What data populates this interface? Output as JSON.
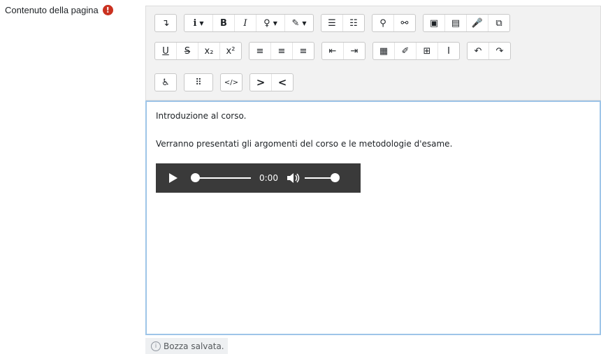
{
  "field": {
    "label": "Contenuto della pagina",
    "required_icon": "exclamation-icon"
  },
  "toolbar": {
    "rows": [
      [
        [
          {
            "name": "collapse-button",
            "icon": "collapse-icon",
            "glyph": "↴"
          }
        ],
        [
          {
            "name": "style-dropdown",
            "icon": "info-i-icon",
            "glyph": "i",
            "caret": true
          },
          {
            "name": "bold-button",
            "icon": "bold-icon",
            "glyph": "B"
          },
          {
            "name": "italic-button",
            "icon": "italic-icon",
            "glyph": "I"
          },
          {
            "name": "accessibility-checker-dropdown",
            "icon": "lightbulb-icon",
            "glyph": "♀",
            "caret": true
          },
          {
            "name": "font-color-dropdown",
            "icon": "paintbrush-icon",
            "glyph": "✎",
            "caret": true
          }
        ],
        [
          {
            "name": "unordered-list-button",
            "icon": "bulleted-list-icon",
            "glyph": "☰"
          },
          {
            "name": "ordered-list-button",
            "icon": "numbered-list-icon",
            "glyph": "☷"
          }
        ],
        [
          {
            "name": "link-button",
            "icon": "link-icon",
            "glyph": "⚲"
          },
          {
            "name": "unlink-button",
            "icon": "unlink-icon",
            "glyph": "⚯"
          }
        ],
        [
          {
            "name": "insert-image-button",
            "icon": "image-icon",
            "glyph": "▣"
          },
          {
            "name": "insert-media-button",
            "icon": "media-icon",
            "glyph": "▤"
          },
          {
            "name": "record-audio-button",
            "icon": "microphone-icon",
            "glyph": "🎤"
          },
          {
            "name": "manage-files-button",
            "icon": "files-icon",
            "glyph": "⧉"
          }
        ]
      ],
      [
        [
          {
            "name": "underline-button",
            "icon": "underline-icon",
            "glyph": "U"
          },
          {
            "name": "strikethrough-button",
            "icon": "strikethrough-icon",
            "glyph": "S"
          },
          {
            "name": "subscript-button",
            "icon": "subscript-icon",
            "glyph": "x₂"
          },
          {
            "name": "superscript-button",
            "icon": "superscript-icon",
            "glyph": "x²"
          }
        ],
        [
          {
            "name": "align-left-button",
            "icon": "align-left-icon",
            "glyph": "≡"
          },
          {
            "name": "align-center-button",
            "icon": "align-center-icon",
            "glyph": "≡"
          },
          {
            "name": "align-right-button",
            "icon": "align-right-icon",
            "glyph": "≡"
          }
        ],
        [
          {
            "name": "outdent-button",
            "icon": "outdent-icon",
            "glyph": "⇤"
          },
          {
            "name": "indent-button",
            "icon": "indent-icon",
            "glyph": "⇥"
          }
        ],
        [
          {
            "name": "equation-button",
            "icon": "calculator-icon",
            "glyph": "▦"
          },
          {
            "name": "special-chars-button",
            "icon": "edit-icon",
            "glyph": "✐"
          },
          {
            "name": "table-button",
            "icon": "table-icon",
            "glyph": "⊞"
          },
          {
            "name": "clear-formatting-button",
            "icon": "cursor-icon",
            "glyph": "I"
          }
        ],
        [
          {
            "name": "undo-button",
            "icon": "undo-icon",
            "glyph": "↶"
          },
          {
            "name": "redo-button",
            "icon": "redo-icon",
            "glyph": "↷"
          }
        ]
      ],
      [
        [
          {
            "name": "accessibility-helper-button",
            "icon": "accessibility-icon",
            "glyph": "♿"
          }
        ],
        [
          {
            "name": "screenreader-helper-button",
            "icon": "braille-icon",
            "glyph": "⠿",
            "wide": true
          }
        ],
        [
          {
            "name": "html-source-button",
            "icon": "code-icon",
            "glyph": "</>"
          }
        ],
        [
          {
            "name": "direction-ltr-button",
            "icon": "chevron-right-icon",
            "glyph": ">"
          },
          {
            "name": "direction-rtl-button",
            "icon": "chevron-left-icon",
            "glyph": "<"
          }
        ]
      ]
    ]
  },
  "content": {
    "paragraph_1": "Introduzione al corso.",
    "paragraph_2": "Verranno presentati gli argomenti del corso e le metodologie d'esame.",
    "audio": {
      "time": "0:00",
      "progress": 0.0,
      "volume": 1.0
    }
  },
  "status": {
    "text": "Bozza salvata."
  },
  "colors": {
    "required": "#ca3120",
    "editor_border": "#9ec5e8",
    "player_bg": "#3a3a3a"
  }
}
